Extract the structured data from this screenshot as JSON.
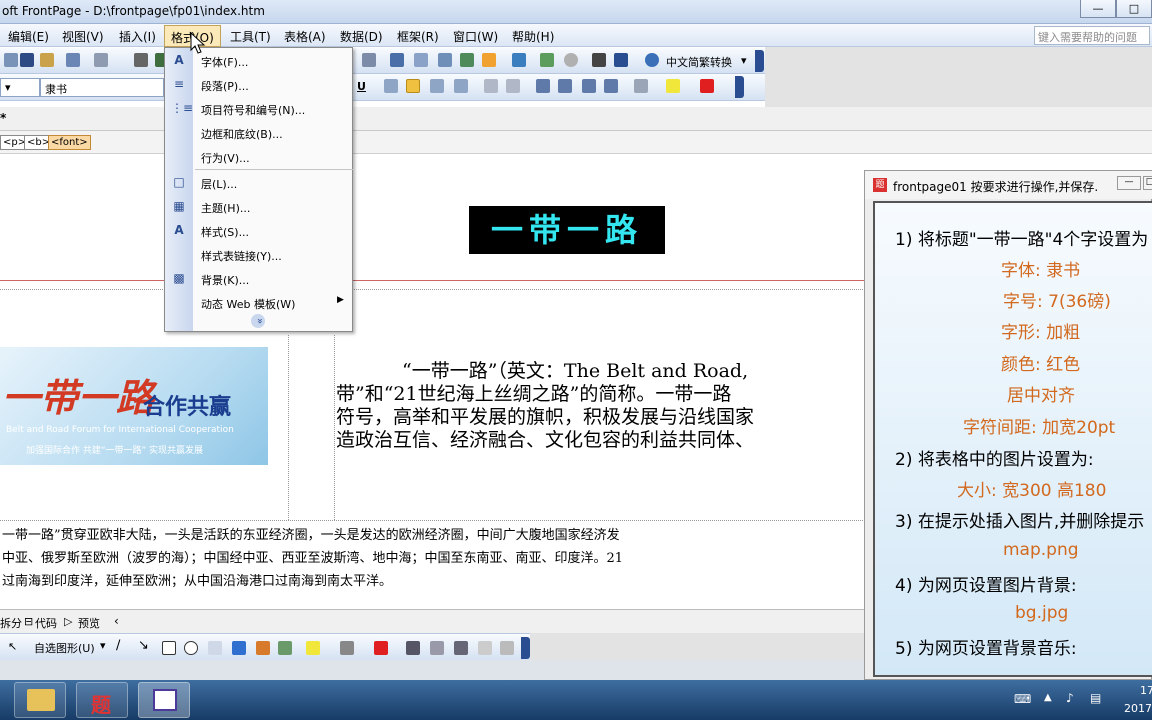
{
  "window": {
    "title": "oft FrontPage - D:\\frontpage\\fp01\\index.htm",
    "min": "—",
    "max": "□"
  },
  "menubar": {
    "items": [
      "编辑(E)",
      "视图(V)",
      "插入(I)",
      "格式(O)",
      "工具(T)",
      "表格(A)",
      "数据(D)",
      "框架(R)",
      "窗口(W)",
      "帮助(H)"
    ],
    "help_placeholder": "键入需要帮助的问题"
  },
  "toolbar": {
    "chinese_convert": "中文简繁转换",
    "font": "隶书",
    "underline": "U"
  },
  "editor": {
    "tab_label": "*",
    "tags": [
      "<p>",
      "<b>",
      "<font>"
    ],
    "banner_title": "一带一路",
    "logo": {
      "main": "一带一路",
      "tagline": "合作共赢",
      "english": "Belt and Road Forum for International Cooperation",
      "slogan": "加强国际合作  共建“一带一路”  实现共赢发展"
    },
    "para1": [
      "“一带一路”（英文：The Belt and Road,",
      "带”和“21世纪海上丝绸之路”的简称。一带一路",
      "符号，高举和平发展的旗帜，积极发展与沿线国家",
      "造政治互信、经济融合、文化包容的利益共同体、"
    ],
    "para2": [
      "一带一路”贯穿亚欧非大陆，一头是活跃的东亚经济圈，一头是发达的欧洲经济圈，中间广大腹地国家经济发",
      "中亚、俄罗斯至欧洲（波罗的海）；中国经中亚、西亚至波斯湾、地中海；中国至东南亚、南亚、印度洋。21",
      "过南海到印度洋，延伸至欧洲；从中国沿海港口过南海到南太平洋。"
    ]
  },
  "viewtabs": [
    "拆分",
    "代码",
    "预览"
  ],
  "drawbar": {
    "autoshapes": "自选图形(U)"
  },
  "format_menu": {
    "items": [
      {
        "label": "字体(F)...",
        "icon": "font-icon"
      },
      {
        "label": "段落(P)...",
        "icon": "paragraph-icon"
      },
      {
        "label": "项目符号和编号(N)...",
        "icon": "bullets-icon"
      },
      {
        "label": "边框和底纹(B)...",
        "icon": ""
      },
      {
        "label": "行为(V)...",
        "icon": ""
      },
      {
        "label": "层(L)...",
        "icon": "layer-icon"
      },
      {
        "label": "主题(H)...",
        "icon": "theme-icon"
      },
      {
        "label": "样式(S)...",
        "icon": "style-icon"
      },
      {
        "label": "样式表链接(Y)...",
        "icon": ""
      },
      {
        "label": "背景(K)...",
        "icon": "background-icon"
      },
      {
        "label": "动态 Web 模板(W)",
        "icon": ""
      }
    ],
    "expand": "»"
  },
  "task_panel": {
    "title": "frontpage01 按要求进行操作,并保存.",
    "lines": [
      {
        "text": "1) 将标题\"一带一路\"4个字设置为",
        "kind": "step"
      },
      {
        "text": "字体: 隶书",
        "kind": "opt"
      },
      {
        "text": "字号: 7(36磅)",
        "kind": "opt"
      },
      {
        "text": "字形: 加粗",
        "kind": "opt"
      },
      {
        "text": "颜色: 红色",
        "kind": "opt"
      },
      {
        "text": "居中对齐",
        "kind": "opt"
      },
      {
        "text": "字符间距: 加宽20pt",
        "kind": "opt"
      },
      {
        "text": "2) 将表格中的图片设置为:",
        "kind": "step"
      },
      {
        "text": "大小: 宽300    高180",
        "kind": "opt"
      },
      {
        "text": "3) 在提示处插入图片,并删除提示",
        "kind": "step"
      },
      {
        "text": "map.png",
        "kind": "opt"
      },
      {
        "text": "4) 为网页设置图片背景:",
        "kind": "step"
      },
      {
        "text": "bg.jpg",
        "kind": "opt"
      },
      {
        "text": "5) 为网页设置背景音乐:",
        "kind": "step"
      }
    ]
  },
  "taskbar": {
    "q_label": "题",
    "clock": "17",
    "date": "2017"
  },
  "colors": {
    "accent": "#2a4c90",
    "task_orange": "#d2691e",
    "title_cyan": "#34e6f0"
  }
}
